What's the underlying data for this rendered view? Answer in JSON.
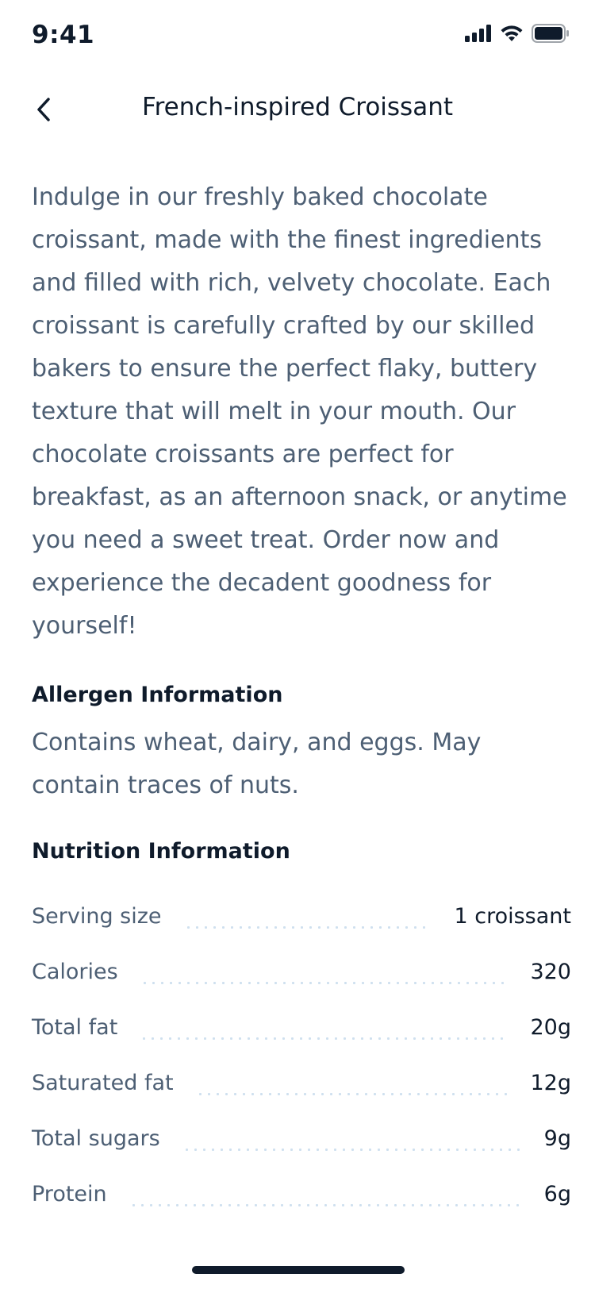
{
  "status_bar": {
    "time": "9:41",
    "icons": [
      "cellular-signal-icon",
      "wifi-icon",
      "battery-icon"
    ]
  },
  "header": {
    "title": "French-inspired Croissant",
    "back_icon": "chevron-left-icon"
  },
  "description": "Indulge in our freshly baked chocolate croissant, made with the finest ingredients and filled with rich, velvety chocolate. Each croissant is carefully crafted by our skilled bakers to ensure the perfect flaky, buttery texture that will melt in your mouth. Our chocolate croissants are perfect for breakfast, as an afternoon snack, or anytime you need a sweet treat. Order now and experience the decadent goodness for yourself!",
  "allergen": {
    "heading": "Allergen Information",
    "text": "Contains wheat, dairy, and eggs. May contain traces of nuts."
  },
  "nutrition": {
    "heading": "Nutrition Information",
    "rows": [
      {
        "label": "Serving size",
        "value": "1 croissant"
      },
      {
        "label": "Calories",
        "value": "320"
      },
      {
        "label": "Total fat",
        "value": "20g"
      },
      {
        "label": "Saturated fat",
        "value": "12g"
      },
      {
        "label": "Total sugars",
        "value": "9g"
      },
      {
        "label": "Protein",
        "value": "6g"
      }
    ]
  },
  "colors": {
    "title": "#0f1b2b",
    "body_text": "#4d5f74",
    "dots": "#cfe0ef"
  }
}
